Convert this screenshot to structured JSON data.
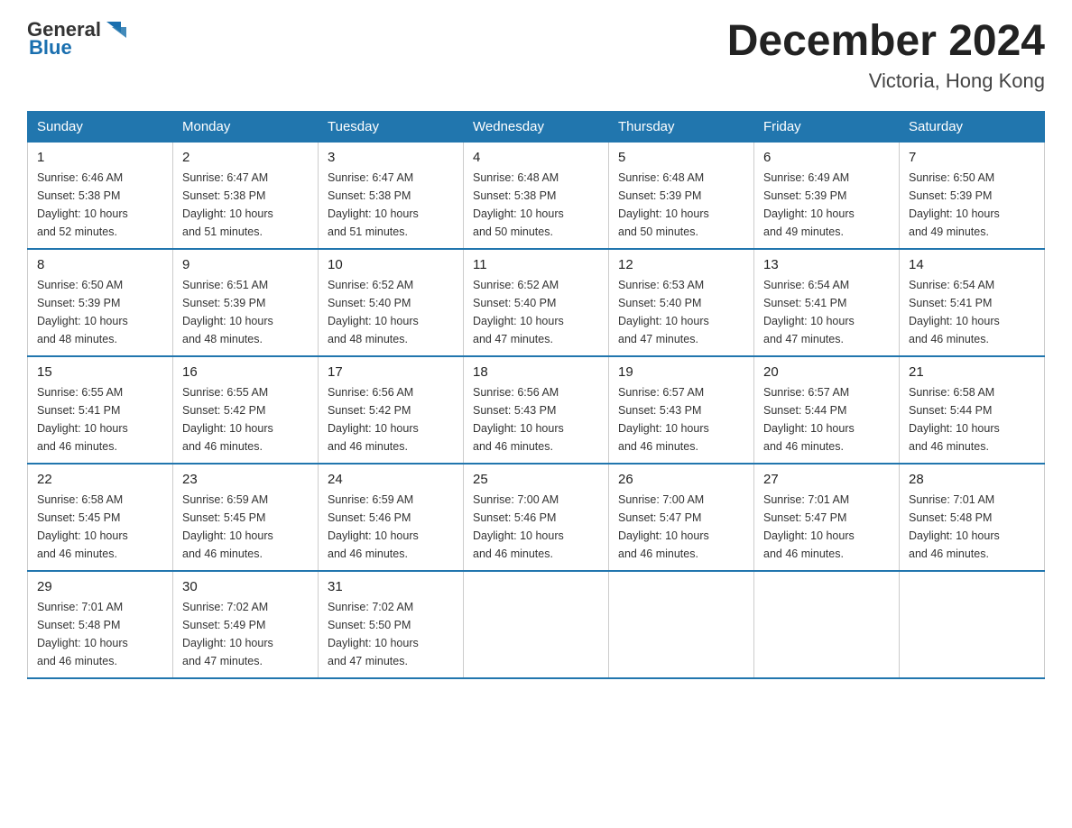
{
  "logo": {
    "text_general": "General",
    "text_blue": "Blue"
  },
  "title": "December 2024",
  "location": "Victoria, Hong Kong",
  "days_of_week": [
    "Sunday",
    "Monday",
    "Tuesday",
    "Wednesday",
    "Thursday",
    "Friday",
    "Saturday"
  ],
  "weeks": [
    [
      {
        "day": "1",
        "sunrise": "6:46 AM",
        "sunset": "5:38 PM",
        "daylight": "10 hours and 52 minutes."
      },
      {
        "day": "2",
        "sunrise": "6:47 AM",
        "sunset": "5:38 PM",
        "daylight": "10 hours and 51 minutes."
      },
      {
        "day": "3",
        "sunrise": "6:47 AM",
        "sunset": "5:38 PM",
        "daylight": "10 hours and 51 minutes."
      },
      {
        "day": "4",
        "sunrise": "6:48 AM",
        "sunset": "5:38 PM",
        "daylight": "10 hours and 50 minutes."
      },
      {
        "day": "5",
        "sunrise": "6:48 AM",
        "sunset": "5:39 PM",
        "daylight": "10 hours and 50 minutes."
      },
      {
        "day": "6",
        "sunrise": "6:49 AM",
        "sunset": "5:39 PM",
        "daylight": "10 hours and 49 minutes."
      },
      {
        "day": "7",
        "sunrise": "6:50 AM",
        "sunset": "5:39 PM",
        "daylight": "10 hours and 49 minutes."
      }
    ],
    [
      {
        "day": "8",
        "sunrise": "6:50 AM",
        "sunset": "5:39 PM",
        "daylight": "10 hours and 48 minutes."
      },
      {
        "day": "9",
        "sunrise": "6:51 AM",
        "sunset": "5:39 PM",
        "daylight": "10 hours and 48 minutes."
      },
      {
        "day": "10",
        "sunrise": "6:52 AM",
        "sunset": "5:40 PM",
        "daylight": "10 hours and 48 minutes."
      },
      {
        "day": "11",
        "sunrise": "6:52 AM",
        "sunset": "5:40 PM",
        "daylight": "10 hours and 47 minutes."
      },
      {
        "day": "12",
        "sunrise": "6:53 AM",
        "sunset": "5:40 PM",
        "daylight": "10 hours and 47 minutes."
      },
      {
        "day": "13",
        "sunrise": "6:54 AM",
        "sunset": "5:41 PM",
        "daylight": "10 hours and 47 minutes."
      },
      {
        "day": "14",
        "sunrise": "6:54 AM",
        "sunset": "5:41 PM",
        "daylight": "10 hours and 46 minutes."
      }
    ],
    [
      {
        "day": "15",
        "sunrise": "6:55 AM",
        "sunset": "5:41 PM",
        "daylight": "10 hours and 46 minutes."
      },
      {
        "day": "16",
        "sunrise": "6:55 AM",
        "sunset": "5:42 PM",
        "daylight": "10 hours and 46 minutes."
      },
      {
        "day": "17",
        "sunrise": "6:56 AM",
        "sunset": "5:42 PM",
        "daylight": "10 hours and 46 minutes."
      },
      {
        "day": "18",
        "sunrise": "6:56 AM",
        "sunset": "5:43 PM",
        "daylight": "10 hours and 46 minutes."
      },
      {
        "day": "19",
        "sunrise": "6:57 AM",
        "sunset": "5:43 PM",
        "daylight": "10 hours and 46 minutes."
      },
      {
        "day": "20",
        "sunrise": "6:57 AM",
        "sunset": "5:44 PM",
        "daylight": "10 hours and 46 minutes."
      },
      {
        "day": "21",
        "sunrise": "6:58 AM",
        "sunset": "5:44 PM",
        "daylight": "10 hours and 46 minutes."
      }
    ],
    [
      {
        "day": "22",
        "sunrise": "6:58 AM",
        "sunset": "5:45 PM",
        "daylight": "10 hours and 46 minutes."
      },
      {
        "day": "23",
        "sunrise": "6:59 AM",
        "sunset": "5:45 PM",
        "daylight": "10 hours and 46 minutes."
      },
      {
        "day": "24",
        "sunrise": "6:59 AM",
        "sunset": "5:46 PM",
        "daylight": "10 hours and 46 minutes."
      },
      {
        "day": "25",
        "sunrise": "7:00 AM",
        "sunset": "5:46 PM",
        "daylight": "10 hours and 46 minutes."
      },
      {
        "day": "26",
        "sunrise": "7:00 AM",
        "sunset": "5:47 PM",
        "daylight": "10 hours and 46 minutes."
      },
      {
        "day": "27",
        "sunrise": "7:01 AM",
        "sunset": "5:47 PM",
        "daylight": "10 hours and 46 minutes."
      },
      {
        "day": "28",
        "sunrise": "7:01 AM",
        "sunset": "5:48 PM",
        "daylight": "10 hours and 46 minutes."
      }
    ],
    [
      {
        "day": "29",
        "sunrise": "7:01 AM",
        "sunset": "5:48 PM",
        "daylight": "10 hours and 46 minutes."
      },
      {
        "day": "30",
        "sunrise": "7:02 AM",
        "sunset": "5:49 PM",
        "daylight": "10 hours and 47 minutes."
      },
      {
        "day": "31",
        "sunrise": "7:02 AM",
        "sunset": "5:50 PM",
        "daylight": "10 hours and 47 minutes."
      },
      null,
      null,
      null,
      null
    ]
  ],
  "labels": {
    "sunrise": "Sunrise:",
    "sunset": "Sunset:",
    "daylight": "Daylight:"
  }
}
